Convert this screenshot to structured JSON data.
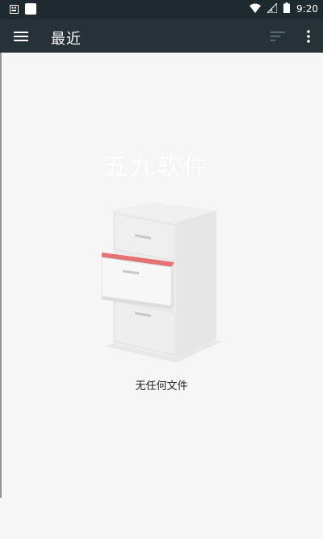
{
  "status_bar": {
    "time": "9:20",
    "left_icons": [
      "notification-icon",
      "app-icon"
    ],
    "right_icons": [
      "wifi-icon",
      "signal-icon",
      "battery-icon"
    ]
  },
  "app_bar": {
    "title": "最近",
    "menu_icon": "hamburger-menu-icon",
    "sort_icon": "sort-icon",
    "more_icon": "more-vert-icon",
    "background": "#263238"
  },
  "content": {
    "watermark": "五九软件",
    "empty_message": "无任何文件",
    "illustration": "file-cabinet-icon",
    "accent": "#e57373"
  }
}
